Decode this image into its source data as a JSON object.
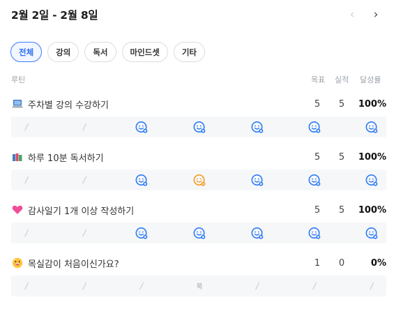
{
  "header": {
    "period": "2월 2일 - 2월 8일",
    "prev_icon": "chevron-left-icon",
    "next_icon": "chevron-right-icon",
    "prev_symbol": "‹",
    "next_symbol": "›"
  },
  "filters": [
    {
      "label": "전체",
      "selected": true
    },
    {
      "label": "강의",
      "selected": false
    },
    {
      "label": "독서",
      "selected": false
    },
    {
      "label": "마인드셋",
      "selected": false
    },
    {
      "label": "기타",
      "selected": false
    }
  ],
  "columns": {
    "routine": "루틴",
    "goal": "목표",
    "actual": "실적",
    "rate": "달성률"
  },
  "colors": {
    "accent": "#2a6df4",
    "done": "#2c7bf6",
    "special": "#f59a23",
    "row_bg": "#f6f7f9"
  },
  "routines": [
    {
      "icon": "laptop-icon",
      "name": "주차별 강의 수강하기",
      "goal": "5",
      "actual": "5",
      "rate": "100%",
      "days": [
        "none",
        "none",
        "done",
        "done",
        "done",
        "done",
        "done"
      ],
      "day_labels": [
        "/",
        "/",
        "",
        "",
        "",
        "",
        ""
      ]
    },
    {
      "icon": "books-icon",
      "name": "하루 10분 독서하기",
      "goal": "5",
      "actual": "5",
      "rate": "100%",
      "days": [
        "none",
        "none",
        "done",
        "special",
        "done",
        "done",
        "done"
      ],
      "day_labels": [
        "/",
        "/",
        "",
        "",
        "",
        "",
        ""
      ]
    },
    {
      "icon": "pink-heart-icon",
      "name": "감사일기 1개 이상 작성하기",
      "goal": "5",
      "actual": "5",
      "rate": "100%",
      "days": [
        "none",
        "none",
        "done",
        "done",
        "done",
        "done",
        "done"
      ],
      "day_labels": [
        "/",
        "/",
        "",
        "",
        "",
        "",
        ""
      ]
    },
    {
      "icon": "grinning-face-icon",
      "name": "목실감이 처음이신가요?",
      "goal": "1",
      "actual": "0",
      "rate": "0%",
      "days": [
        "none",
        "none",
        "none",
        "label",
        "none",
        "none",
        "none"
      ],
      "day_labels": [
        "/",
        "/",
        "/",
        "목",
        "/",
        "/",
        "/"
      ]
    }
  ]
}
